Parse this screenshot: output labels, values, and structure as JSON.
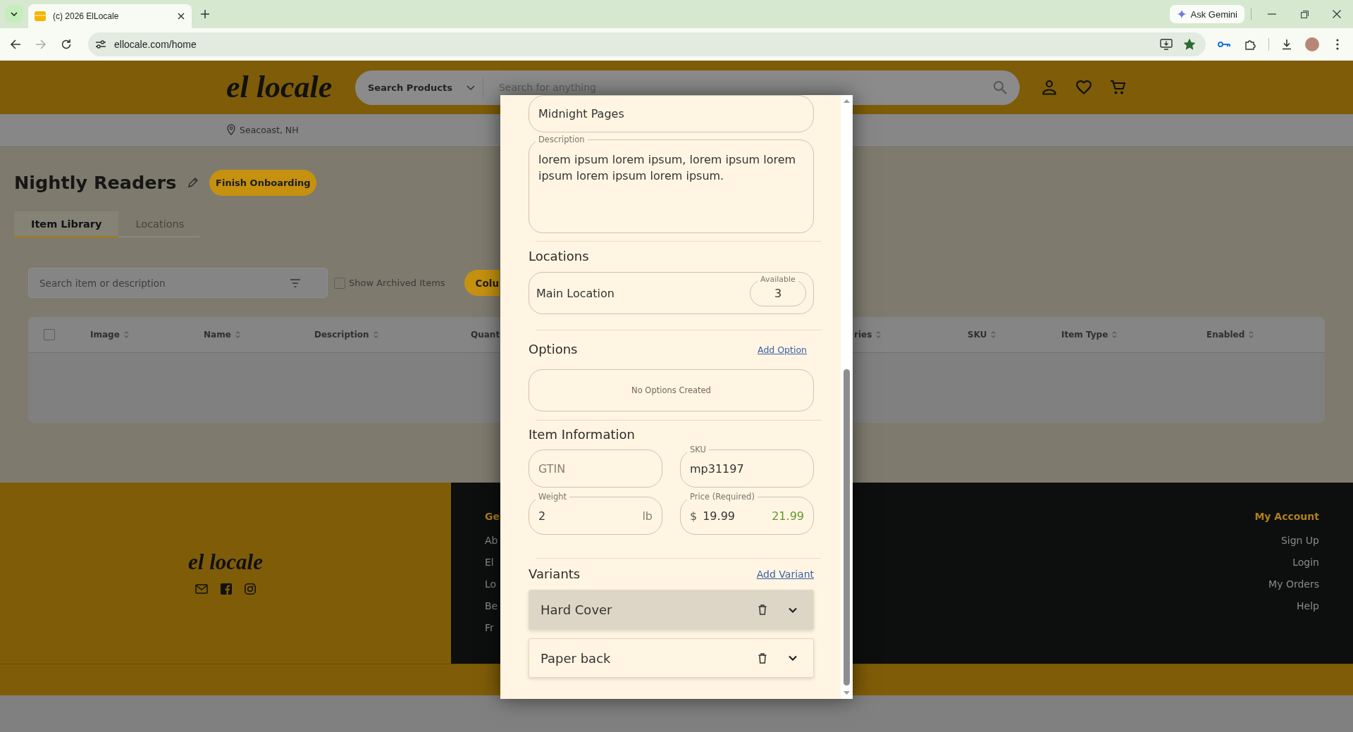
{
  "browser": {
    "tab_title": "(c) 2026 ElLocale",
    "gemini_button": "Ask Gemini",
    "url": "ellocale.com/home",
    "forward_disabled": true,
    "bookmarked": true
  },
  "header": {
    "logo": "el locale",
    "search_category": "Search Products",
    "search_placeholder": "Search for anything"
  },
  "location": "Seacoast, NH",
  "store": {
    "title": "Nightly Readers",
    "action_button": "Finish Onboarding"
  },
  "tabs": [
    {
      "label": "Item Library",
      "selected": true
    },
    {
      "label": "Locations",
      "selected": false
    }
  ],
  "toolbar": {
    "search_placeholder": "Search item or description",
    "archived": {
      "label": "Show Archived Items",
      "checked": false
    },
    "button": "Colu"
  },
  "table": {
    "select_all": {
      "checked": false
    },
    "columns": [
      "Image",
      "Name",
      "Description",
      "Quant",
      "ries",
      "SKU",
      "Item Type",
      "Enabled"
    ]
  },
  "footer": {
    "logo": "el locale",
    "columns": [
      {
        "heading": "Ge",
        "links": [
          "Ab",
          "El",
          "Lo",
          "Be",
          "Fr"
        ]
      },
      {
        "heading": "My Account",
        "links": [
          "Sign Up",
          "Login",
          "My Orders",
          "Help"
        ]
      }
    ]
  },
  "modal": {
    "name_value": "Midnight Pages",
    "description": {
      "label": "Description",
      "value": "lorem ipsum lorem ipsum, lorem ipsum lorem ipsum lorem ipsum lorem ipsum."
    },
    "locations": {
      "heading": "Locations",
      "items": [
        {
          "name": "Main Location",
          "available_label": "Available",
          "available": "3"
        }
      ]
    },
    "options": {
      "heading": "Options",
      "add_link": "Add Option",
      "empty_text": "No Options Created"
    },
    "item_information": {
      "heading": "Item Information",
      "gtin": {
        "placeholder": "GTIN"
      },
      "sku": {
        "label": "SKU",
        "value": "mp31197"
      },
      "weight": {
        "label": "Weight",
        "value": "2",
        "suffix": "lb"
      },
      "price": {
        "label": "Price (Required)",
        "prefix": "$",
        "value": "19.99",
        "secondary_value": "21.99"
      }
    },
    "variants": {
      "heading": "Variants",
      "add_link": "Add Variant",
      "items": [
        {
          "name": "Hard Cover",
          "selected": true
        },
        {
          "name": "Paper back",
          "selected": false
        }
      ]
    }
  }
}
